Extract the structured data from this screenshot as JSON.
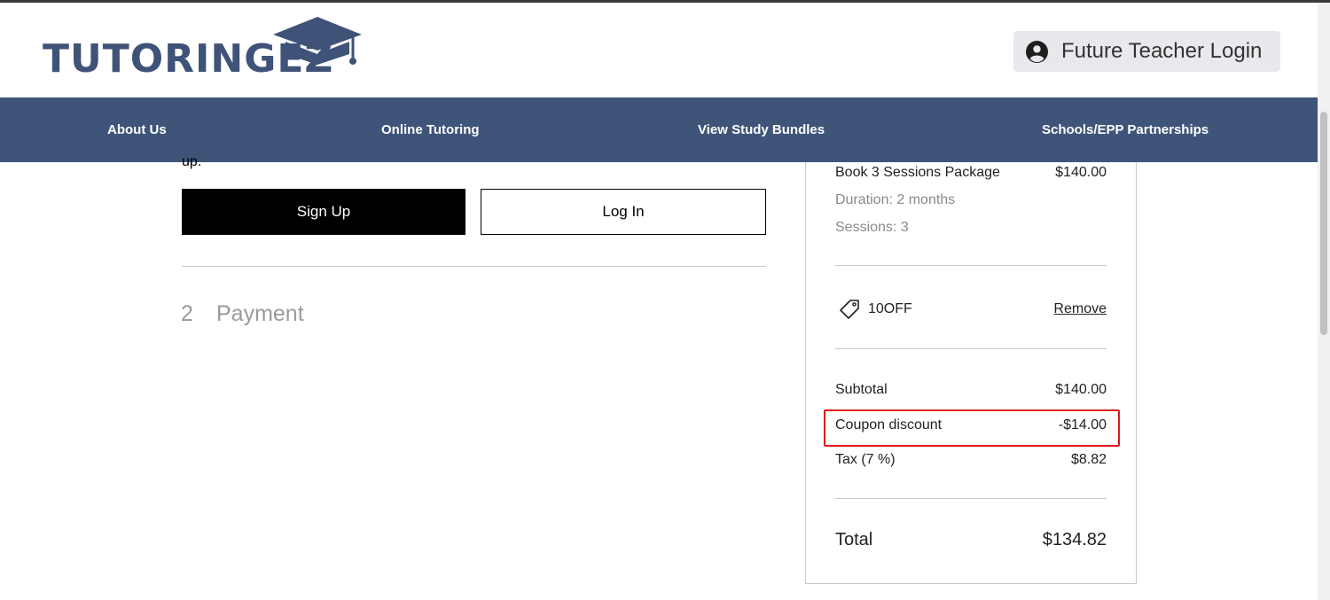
{
  "header": {
    "logo_text": "TUTORINGEZ",
    "login_button": "Future Teacher Login"
  },
  "nav": {
    "items": [
      "About Us",
      "Online Tutoring",
      "View Study Bundles",
      "Schools/EPP Partnerships"
    ]
  },
  "auth": {
    "cut_text": "up.",
    "signup_label": "Sign Up",
    "login_label": "Log In"
  },
  "payment_step": {
    "number": "2",
    "label": "Payment"
  },
  "summary": {
    "item": {
      "name": "Book 3 Sessions Package",
      "price": "$140.00",
      "duration": "Duration: 2 months",
      "sessions": "Sessions: 3"
    },
    "coupon": {
      "code": "10OFF",
      "remove_label": "Remove"
    },
    "subtotal_label": "Subtotal",
    "subtotal_value": "$140.00",
    "discount_label": "Coupon discount",
    "discount_value": "-$14.00",
    "tax_label": "Tax (7 %)",
    "tax_value": "$8.82",
    "total_label": "Total",
    "total_value": "$134.82"
  },
  "colors": {
    "brand": "#3f5479",
    "highlight": "#e0161d"
  },
  "icons": [
    "graduation-cap-icon",
    "user-circle-icon",
    "tag-icon"
  ]
}
